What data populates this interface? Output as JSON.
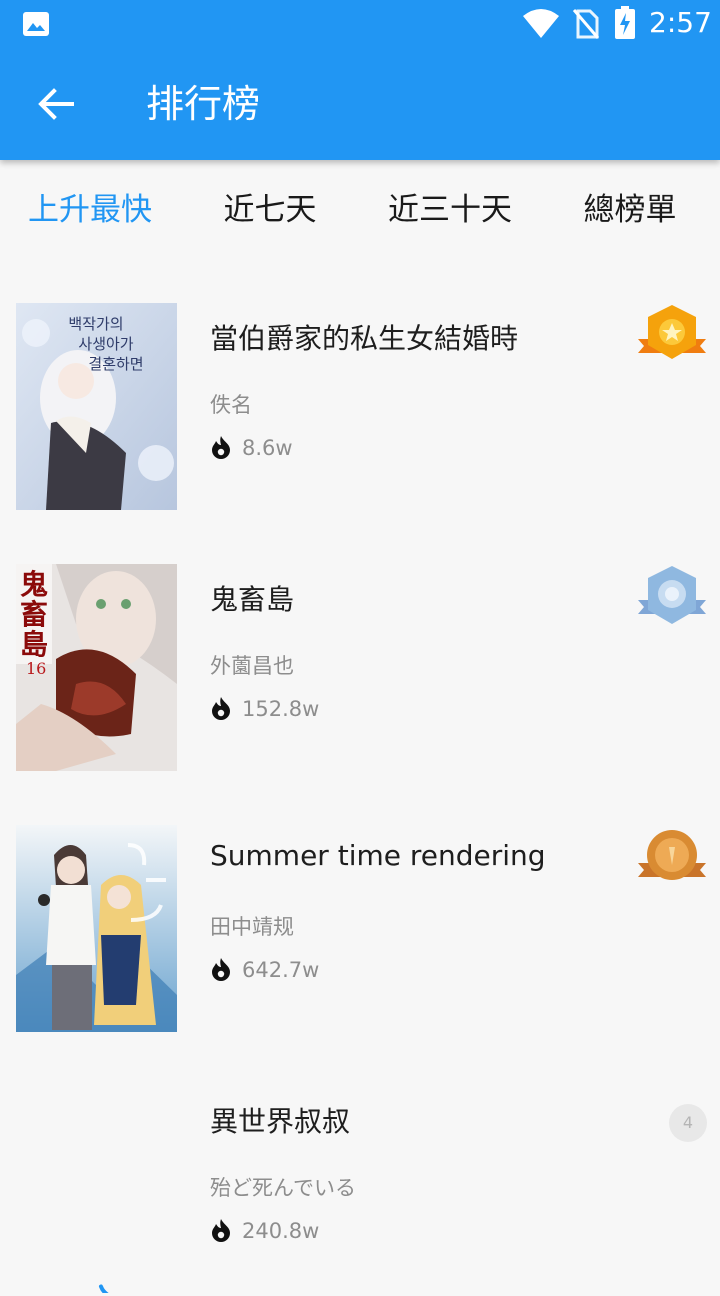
{
  "status_bar": {
    "time": "2:57",
    "icons": [
      "photo-icon",
      "wifi-icon",
      "no-sim-icon",
      "battery-charging-icon"
    ]
  },
  "app_bar": {
    "title": "排行榜",
    "back_icon": "arrow-left-icon"
  },
  "tabs": [
    {
      "label": "上升最快",
      "active": true
    },
    {
      "label": "近七天",
      "active": false
    },
    {
      "label": "近三十天",
      "active": false
    },
    {
      "label": "總榜單",
      "active": false
    }
  ],
  "colors": {
    "accent": "#2196f3",
    "gold": "#f5a20c",
    "silver": "#8fb8e0",
    "bronze": "#d98b32"
  },
  "items": [
    {
      "rank": 1,
      "rank_badge": "gold-medal-icon",
      "title": "當伯爵家的私生女結婚時",
      "author": "佚名",
      "popularity": "8.6w",
      "cover_text": "백작가의 사생아가 결혼하면"
    },
    {
      "rank": 2,
      "rank_badge": "silver-medal-icon",
      "title": "鬼畜島",
      "author": "外薗昌也",
      "popularity": "152.8w",
      "cover_text": "鬼畜島"
    },
    {
      "rank": 3,
      "rank_badge": "bronze-medal-icon",
      "title": "Summer time rendering",
      "author": "田中靖规",
      "popularity": "642.7w",
      "cover_text": ""
    },
    {
      "rank": 4,
      "rank_badge": "4",
      "title": "異世界叔叔",
      "author": "殆ど死んでいる",
      "popularity": "240.8w",
      "cover_text": ""
    }
  ]
}
